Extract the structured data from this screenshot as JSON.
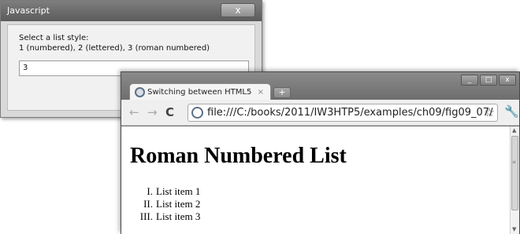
{
  "dialog": {
    "title": "Javascript",
    "close_label": "x",
    "message_line1": "Select a list style:",
    "message_line2": "1 (numbered), 2 (lettered), 3 (roman numbered)",
    "input_value": "3"
  },
  "browser": {
    "tab_title": "Switching between HTML5",
    "tab_close": "×",
    "new_tab": "+",
    "window_buttons": {
      "minimize": "_",
      "maximize": "□",
      "close": "x"
    },
    "nav": {
      "back": "←",
      "forward": "→",
      "reload": "C"
    },
    "url": "file:///C:/books/2011/IW3HTP5/examples/ch09/fig09_07/",
    "icons": {
      "star": "☆",
      "wrench": "🔧",
      "page": "page-icon",
      "tab": "globe-icon"
    }
  },
  "page": {
    "heading": "Roman Numbered List",
    "items": [
      {
        "numeral": "I.",
        "text": "List item 1"
      },
      {
        "numeral": "II.",
        "text": "List item 2"
      },
      {
        "numeral": "III.",
        "text": "List item 3"
      }
    ]
  }
}
